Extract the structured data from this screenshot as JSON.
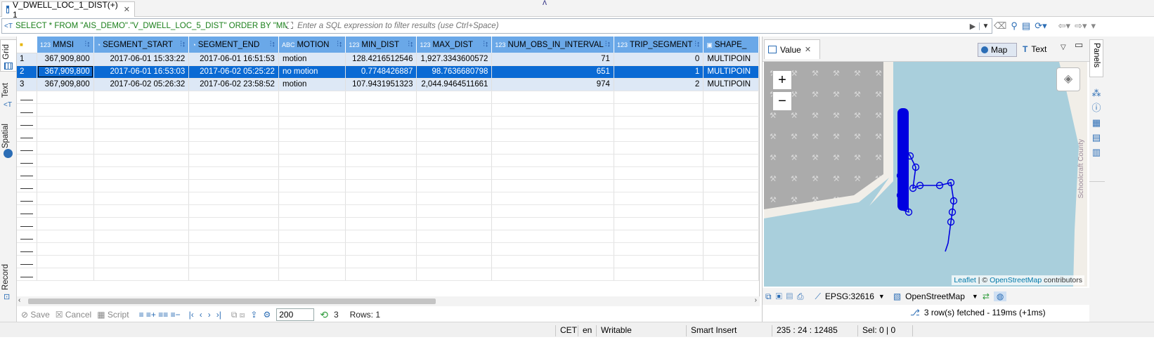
{
  "tab": {
    "title": "V_DWELL_LOC_1_DIST(+) 1"
  },
  "filter": {
    "sql": "SELECT * FROM \"AIS_DEMO\".\"V_DWELL_LOC_5_DIST\" ORDER BY \"MMSI\",",
    "placeholder": "Enter a SQL expression to filter results (use Ctrl+Space)"
  },
  "side_tabs": {
    "grid": "Grid",
    "text": "Text",
    "spatial": "Spatial",
    "record": "Record"
  },
  "columns": [
    {
      "type": "123",
      "name": "MMSI"
    },
    {
      "type": "clock",
      "name": "SEGMENT_START"
    },
    {
      "type": "clock",
      "name": "SEGMENT_END"
    },
    {
      "type": "ABC",
      "name": "MOTION"
    },
    {
      "type": "123",
      "name": "MIN_DIST"
    },
    {
      "type": "123",
      "name": "MAX_DIST"
    },
    {
      "type": "123",
      "name": "NUM_OBS_IN_INTERVAL"
    },
    {
      "type": "123",
      "name": "TRIP_SEGMENT"
    },
    {
      "type": "geo",
      "name": "SHAPE_"
    }
  ],
  "rows": [
    {
      "n": "1",
      "mmsi": "367,909,800",
      "start": "2017-06-01 15:33:22",
      "end": "2017-06-01 16:51:53",
      "motion": "motion",
      "min": "128.4216512546",
      "max": "1,927.3343600572",
      "obs": "71",
      "trip": "0",
      "shape": "MULTIPOIN"
    },
    {
      "n": "2",
      "mmsi": "367,909,800",
      "start": "2017-06-01 16:53:03",
      "end": "2017-06-02 05:25:22",
      "motion": "no motion",
      "min": "0.7748426887",
      "max": "98.7636680798",
      "obs": "651",
      "trip": "1",
      "shape": "MULTIPOIN"
    },
    {
      "n": "3",
      "mmsi": "367,909,800",
      "start": "2017-06-02 05:26:32",
      "end": "2017-06-02 23:58:52",
      "motion": "motion",
      "min": "107.9431951323",
      "max": "2,044.9464511661",
      "obs": "974",
      "trip": "2",
      "shape": "MULTIPOIN"
    }
  ],
  "bottom": {
    "save": "Save",
    "cancel": "Cancel",
    "script": "Script",
    "fetch_size": "200",
    "count": "3",
    "rows": "Rows: 1"
  },
  "value_panel": {
    "tab": "Value",
    "map_btn": "Map",
    "text_btn": "Text",
    "zoom_in": "+",
    "zoom_out": "−",
    "county": "Schoolcraft County",
    "attribution_leaflet": "Leaflet",
    "attribution_sep": " | © ",
    "attribution_osm": "OpenStreetMap",
    "attribution_tail": " contributors",
    "crs": "EPSG:32616",
    "basemap": "OpenStreetMap",
    "fetched": "3 row(s) fetched - 119ms (+1ms)"
  },
  "right": {
    "panels": "Panels"
  },
  "status": {
    "tz": "CET",
    "lang": "en",
    "mode": "Writable",
    "insert": "Smart Insert",
    "pos": "235 : 24 : 12485",
    "sel": "Sel: 0 | 0"
  },
  "colors": {
    "header": "#6aa8e8",
    "selected": "#0a6ad4",
    "alt_row": "#dde8f6",
    "track": "#0000e0",
    "water": "#a9cfdc"
  }
}
